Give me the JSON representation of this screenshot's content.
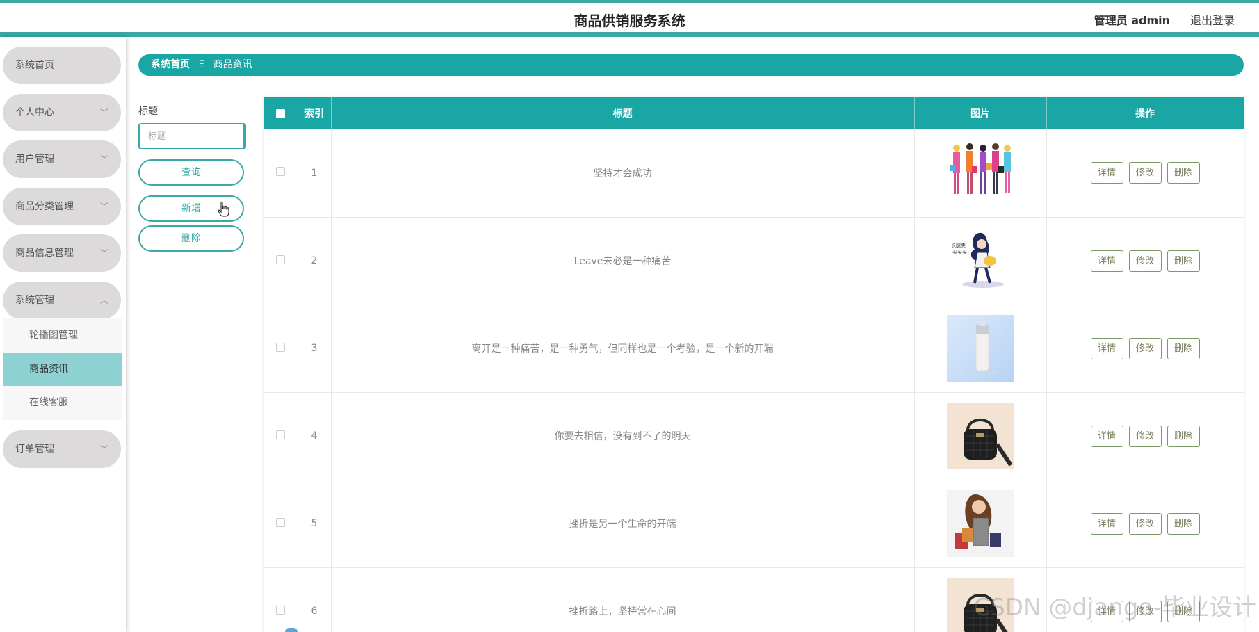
{
  "header": {
    "title": "商品供销服务系统",
    "admin": "管理员 admin",
    "logout": "退出登录"
  },
  "sidebar": {
    "items": [
      {
        "label": "系统首页",
        "has_arrow": false
      },
      {
        "label": "个人中心",
        "has_arrow": true
      },
      {
        "label": "用户管理",
        "has_arrow": true
      },
      {
        "label": "商品分类管理",
        "has_arrow": true
      },
      {
        "label": "商品信息管理",
        "has_arrow": true
      },
      {
        "label": "系统管理",
        "has_arrow": true,
        "expanded": true
      },
      {
        "label": "订单管理",
        "has_arrow": true
      }
    ],
    "submenu": [
      {
        "label": "轮播图管理"
      },
      {
        "label": "商品资讯",
        "active": true
      },
      {
        "label": "在线客服"
      }
    ]
  },
  "breadcrumb": {
    "home": "系统首页",
    "separator": "Ξ",
    "current": "商品资讯"
  },
  "search": {
    "label": "标题",
    "placeholder": "标题",
    "query_button": "查询",
    "add_button": "新增",
    "delete_button": "删除"
  },
  "table": {
    "columns": [
      "索引",
      "标题",
      "图片",
      "操作"
    ],
    "rows": [
      {
        "index": "1",
        "title": "坚持才会成功",
        "image": "shopping-women-illustration"
      },
      {
        "index": "2",
        "title": "Leave未必是一种痛苦",
        "image": "girl-with-bag-illustration"
      },
      {
        "index": "3",
        "title": "离开是一种痛苦，是一种勇气，但同样也是一个考验，是一个新的开端",
        "image": "cosmetic-bottle-photo"
      },
      {
        "index": "4",
        "title": "你要去相信，没有到不了的明天",
        "image": "black-handbag-photo"
      },
      {
        "index": "5",
        "title": "挫折是另一个生命的开端",
        "image": "woman-shopping-bags-photo"
      },
      {
        "index": "6",
        "title": "挫折路上，坚持常在心间",
        "image": "black-handbag-photo"
      }
    ],
    "actions": {
      "detail": "详情",
      "edit": "修改",
      "delete": "删除"
    }
  },
  "watermark": "CSDN @django-毕业设计",
  "colors": {
    "accent": "#1ba6a6",
    "nav_bg": "#dcdadb",
    "active_sub": "#8ed1d2"
  }
}
